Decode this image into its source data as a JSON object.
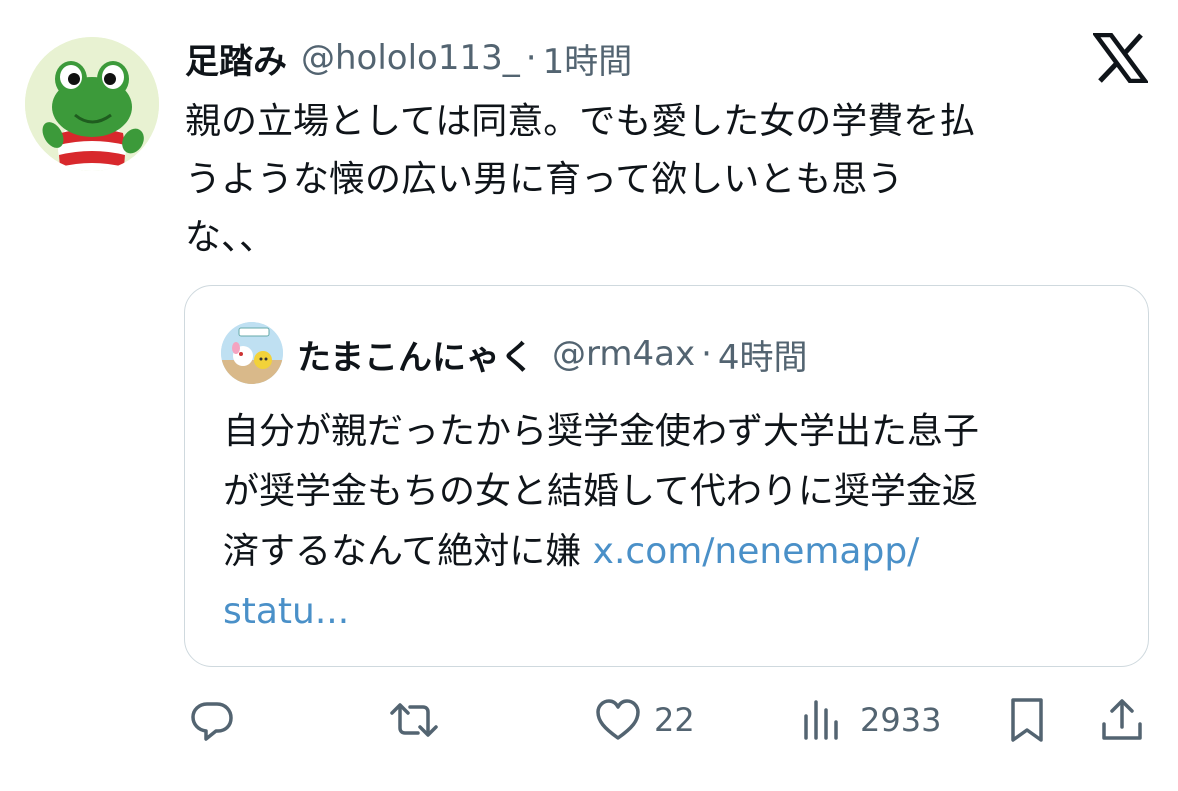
{
  "tweet": {
    "display_name": "足踏み",
    "handle": "@hololo113_",
    "separator": "·",
    "time": "1時間",
    "text_lines": [
      "親の立場としては同意。でも愛した女の学費を払",
      "うような懐の広い男に育って欲しいとも思う",
      "な、、"
    ],
    "avatar_icon": "frog-mascot-avatar",
    "platform_logo": "x-logo"
  },
  "quote": {
    "display_name": "たまこんにゃく",
    "handle": "@rm4ax",
    "separator": "·",
    "time": "4時間",
    "text_lines": [
      "自分が親だったから奨学金使わず大学出た息子",
      "が奨学金もちの女と結婚して代わりに奨学金返",
      "済するなんて絶対に嫌"
    ],
    "link_part1": "x.com/nenemapp/",
    "link_part2": "statu...",
    "avatar_icon": "cartoon-character-avatar"
  },
  "actions": {
    "reply_icon": "reply-icon",
    "retweet_icon": "retweet-icon",
    "like_icon": "heart-icon",
    "like_count": "22",
    "views_icon": "views-chart-icon",
    "views_count": "2933",
    "bookmark_icon": "bookmark-icon",
    "share_icon": "share-icon"
  },
  "colors": {
    "text_primary": "#0f1419",
    "text_secondary": "#536471",
    "link": "#4a90c8",
    "border": "#cfd9de"
  }
}
